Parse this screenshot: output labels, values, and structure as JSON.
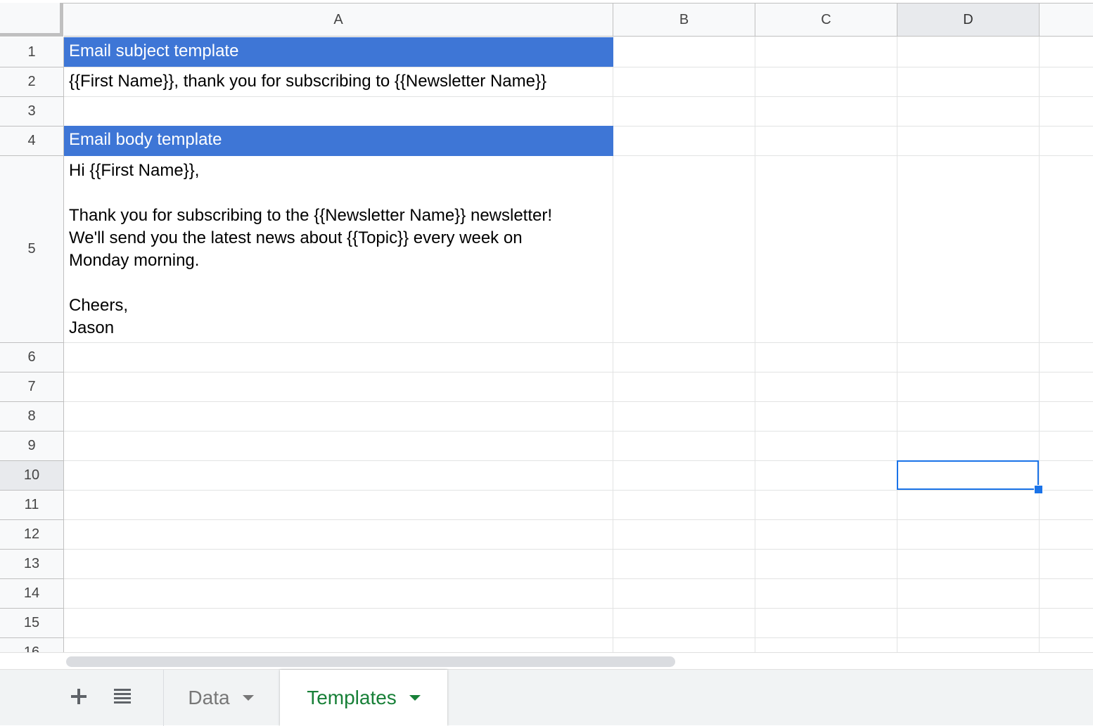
{
  "sheet": {
    "columns": [
      "A",
      "B",
      "C",
      "D"
    ],
    "active_column": "D",
    "rows": [
      "1",
      "2",
      "3",
      "4",
      "5",
      "6",
      "7",
      "8",
      "9",
      "10",
      "11",
      "12",
      "13",
      "14",
      "15",
      "16"
    ],
    "active_row": "10",
    "cells": {
      "A1": "Email subject template",
      "A2": "{{First Name}}, thank you for subscribing to {{Newsletter Name}}",
      "A4": "Email body template",
      "A5": "Hi {{First Name}},\n\nThank you for subscribing to the {{Newsletter Name}} newsletter!\nWe'll send you the latest news about {{Topic}} every week on\nMonday morning.\n\nCheers,\nJason"
    },
    "header_fill_color": "#3e76d6",
    "selected_cell": "D10"
  },
  "tabbar": {
    "add_icon": "plus-icon",
    "list_icon": "all-sheets-icon",
    "tabs": [
      {
        "label": "Data",
        "active": false
      },
      {
        "label": "Templates",
        "active": true
      }
    ],
    "active_color": "#188038"
  }
}
